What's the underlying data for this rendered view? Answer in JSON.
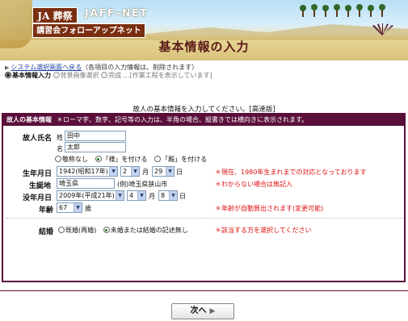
{
  "banner": {
    "logo": "JA 葬祭",
    "brand": "JAFF–NET",
    "subtitle": "講習会フォローアップネット"
  },
  "page_title": "基本情報の入力",
  "nav": {
    "back_link": "システム選択画面へ戻る",
    "back_note": "（各項目の入力情報は、削除されます）",
    "steps": [
      {
        "label": "基本情報入力",
        "current": true
      },
      {
        "label": "背景画像選択",
        "current": false
      },
      {
        "label": "完成",
        "current": false
      }
    ],
    "steps_note": "…[作業工程を表示しています]"
  },
  "intro": "故人の基本情報を入力してください。[高速版]",
  "panel": {
    "title": "故人の基本情報",
    "note": "＊ローマ字、数字、記号等の入力は、半角の場合、縦書きでは横向きに表示されます。"
  },
  "form": {
    "name": {
      "label": "故人氏名",
      "sei_label": "姓",
      "sei_value": "田中",
      "mei_label": "名",
      "mei_value": "太郎",
      "honorifics": [
        {
          "label": "敬称なし",
          "selected": false
        },
        {
          "label": "「様」を付ける",
          "selected": true
        },
        {
          "label": "「殿」を付ける",
          "selected": false
        }
      ]
    },
    "birth": {
      "label": "生年月日",
      "year": "1942(昭和17年)",
      "month": "2",
      "month_unit": "月",
      "day": "29",
      "day_unit": "日",
      "note": "＊現在、1980年生まれまでの対応となっております"
    },
    "birthplace": {
      "label": "生誕地",
      "value": "埼玉県",
      "example": "(例)埼玉県狭山市",
      "note": "＊わからない場合は無記入"
    },
    "death": {
      "label": "没年月日",
      "year": "2009年(平成21年)",
      "month": "4",
      "month_unit": "月",
      "day": "8",
      "day_unit": "日"
    },
    "age": {
      "label": "年齢",
      "value": "67",
      "unit": "歳",
      "note": "＊年齢が自動算出されます(変更可能)"
    },
    "marriage": {
      "label": "結婚",
      "options": [
        {
          "label": "既婚(再婚)",
          "selected": false
        },
        {
          "label": "未婚または結婚の記述無し",
          "selected": true
        }
      ],
      "note": "＊該当する方を選択してください"
    }
  },
  "next_button": "次へ",
  "colors": {
    "accent": "#5a0f3a",
    "note_red": "#e01010",
    "link": "#1f3fa6"
  }
}
